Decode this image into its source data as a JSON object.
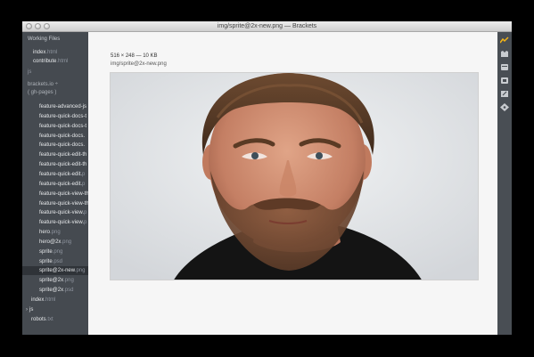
{
  "window": {
    "title": "img/sprite@2x-new.png — Brackets"
  },
  "working_files": {
    "heading": "Working Files",
    "items": [
      {
        "name": "index",
        "ext": ".html"
      },
      {
        "name": "contribute",
        "ext": ".html"
      }
    ],
    "js_label": "js"
  },
  "project": {
    "name": "brackets.io ÷",
    "branch": "( gh-pages )"
  },
  "tree": [
    {
      "name": "feature-advanced-js",
      "ext": "",
      "indent": 2
    },
    {
      "name": "feature-quick-docs-t",
      "ext": "",
      "indent": 2
    },
    {
      "name": "feature-quick-docs-t",
      "ext": "",
      "indent": 2
    },
    {
      "name": "feature-quick-docs.",
      "ext": "",
      "indent": 2
    },
    {
      "name": "feature-quick-docs.",
      "ext": "",
      "indent": 2
    },
    {
      "name": "feature-quick-edit-th",
      "ext": "",
      "indent": 2
    },
    {
      "name": "feature-quick-edit-th",
      "ext": "",
      "indent": 2
    },
    {
      "name": "feature-quick-edit.",
      "ext": "p",
      "indent": 2
    },
    {
      "name": "feature-quick-edit.",
      "ext": "p",
      "indent": 2
    },
    {
      "name": "feature-quick-view-th",
      "ext": "",
      "indent": 2
    },
    {
      "name": "feature-quick-view-th",
      "ext": "",
      "indent": 2
    },
    {
      "name": "feature-quick-view.",
      "ext": "p",
      "indent": 2
    },
    {
      "name": "feature-quick-view.",
      "ext": "p",
      "indent": 2
    },
    {
      "name": "hero",
      "ext": ".png",
      "indent": 2
    },
    {
      "name": "hero@2x",
      "ext": ".png",
      "indent": 2
    },
    {
      "name": "sprite",
      "ext": ".png",
      "indent": 2
    },
    {
      "name": "sprite",
      "ext": ".psd",
      "indent": 2
    },
    {
      "name": "sprite@2x-new",
      "ext": ".png",
      "indent": 2,
      "selected": true
    },
    {
      "name": "sprite@2x",
      "ext": ".png",
      "indent": 2
    },
    {
      "name": "sprite@2x",
      "ext": ".psd",
      "indent": 2
    },
    {
      "name": "index",
      "ext": ".html",
      "indent": 1
    },
    {
      "name": "js",
      "ext": "",
      "indent": 0,
      "folder": true
    },
    {
      "name": "robots",
      "ext": ".txt",
      "indent": 1
    }
  ],
  "viewer": {
    "dimensions": "516 × 248 — 10 KB",
    "path": "img/sprite@2x-new.png"
  },
  "toolbar": {
    "icons": [
      "live-preview-icon",
      "extension-manager-icon",
      "inspector-icon",
      "settings-icon",
      "resize-icon",
      "git-icon"
    ],
    "accent": "#f5b516"
  }
}
